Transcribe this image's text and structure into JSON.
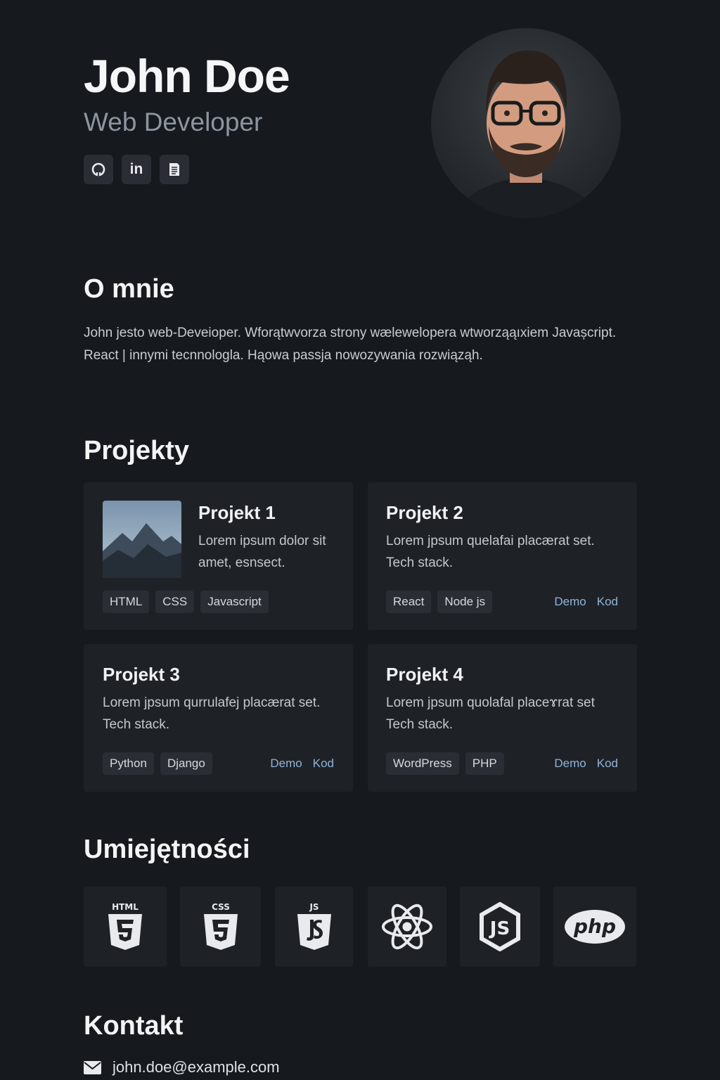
{
  "header": {
    "name": "John Doe",
    "role": "Web Developer",
    "socials": [
      {
        "label": "GitHub",
        "icon": "github-icon"
      },
      {
        "label": "LinkedIn",
        "icon": "linkedin-icon",
        "text": "in"
      },
      {
        "label": "CV",
        "icon": "document-icon"
      }
    ]
  },
  "about": {
    "title": "O mnie",
    "text": "John jesto web-Deveioper. Wforątwvorza strony wælewelopera wtworząąıxiem Javașcript. React | innymi tecnnologla. Hąowa passja nowozywania rozwiąząh."
  },
  "projects": {
    "title": "Projekty",
    "items": [
      {
        "title": "Projekt 1",
        "desc": "Lorem ipsum dolor sit amet, esnsect.",
        "tags": [
          "HTML",
          "CSS",
          "Javascript"
        ],
        "links": []
      },
      {
        "title": "Projekt 2",
        "desc": "Lorem jpsum quelafai placærat set. Tech stack.",
        "tags": [
          "React",
          "Node js"
        ],
        "links": [
          "Demo",
          "Kod"
        ]
      },
      {
        "title": "Projekt 3",
        "desc": "Lorem jpsum qurrulafej placærat set. Tech stack.",
        "tags": [
          "Python",
          "Django"
        ],
        "links": [
          "Demo",
          "Kod"
        ]
      },
      {
        "title": "Projekt 4",
        "desc": "Lorem jpsum quolafal placeɤrat set Tech stack.",
        "tags": [
          "WordPress",
          "PHP"
        ],
        "links": [
          "Demo",
          "Kod"
        ]
      }
    ]
  },
  "skills": {
    "title": "Umiejętności",
    "items": [
      {
        "name": "HTML",
        "badge": "HTML",
        "icon": "html5-icon"
      },
      {
        "name": "CSS",
        "badge": "CSS",
        "icon": "css3-icon"
      },
      {
        "name": "JS",
        "badge": "JS",
        "icon": "javascript-icon"
      },
      {
        "name": "React",
        "icon": "react-icon"
      },
      {
        "name": "Node.js",
        "badge": "JS",
        "icon": "nodejs-icon"
      },
      {
        "name": "PHP",
        "badge": "php",
        "icon": "php-icon"
      }
    ]
  },
  "contact": {
    "title": "Kontakt",
    "email": "john.doe@example.com",
    "icon": "mail-icon"
  },
  "colors": {
    "background": "#16191d",
    "card": "#1e2227",
    "link": "#8fb3d9",
    "muted": "#8c95a0"
  }
}
